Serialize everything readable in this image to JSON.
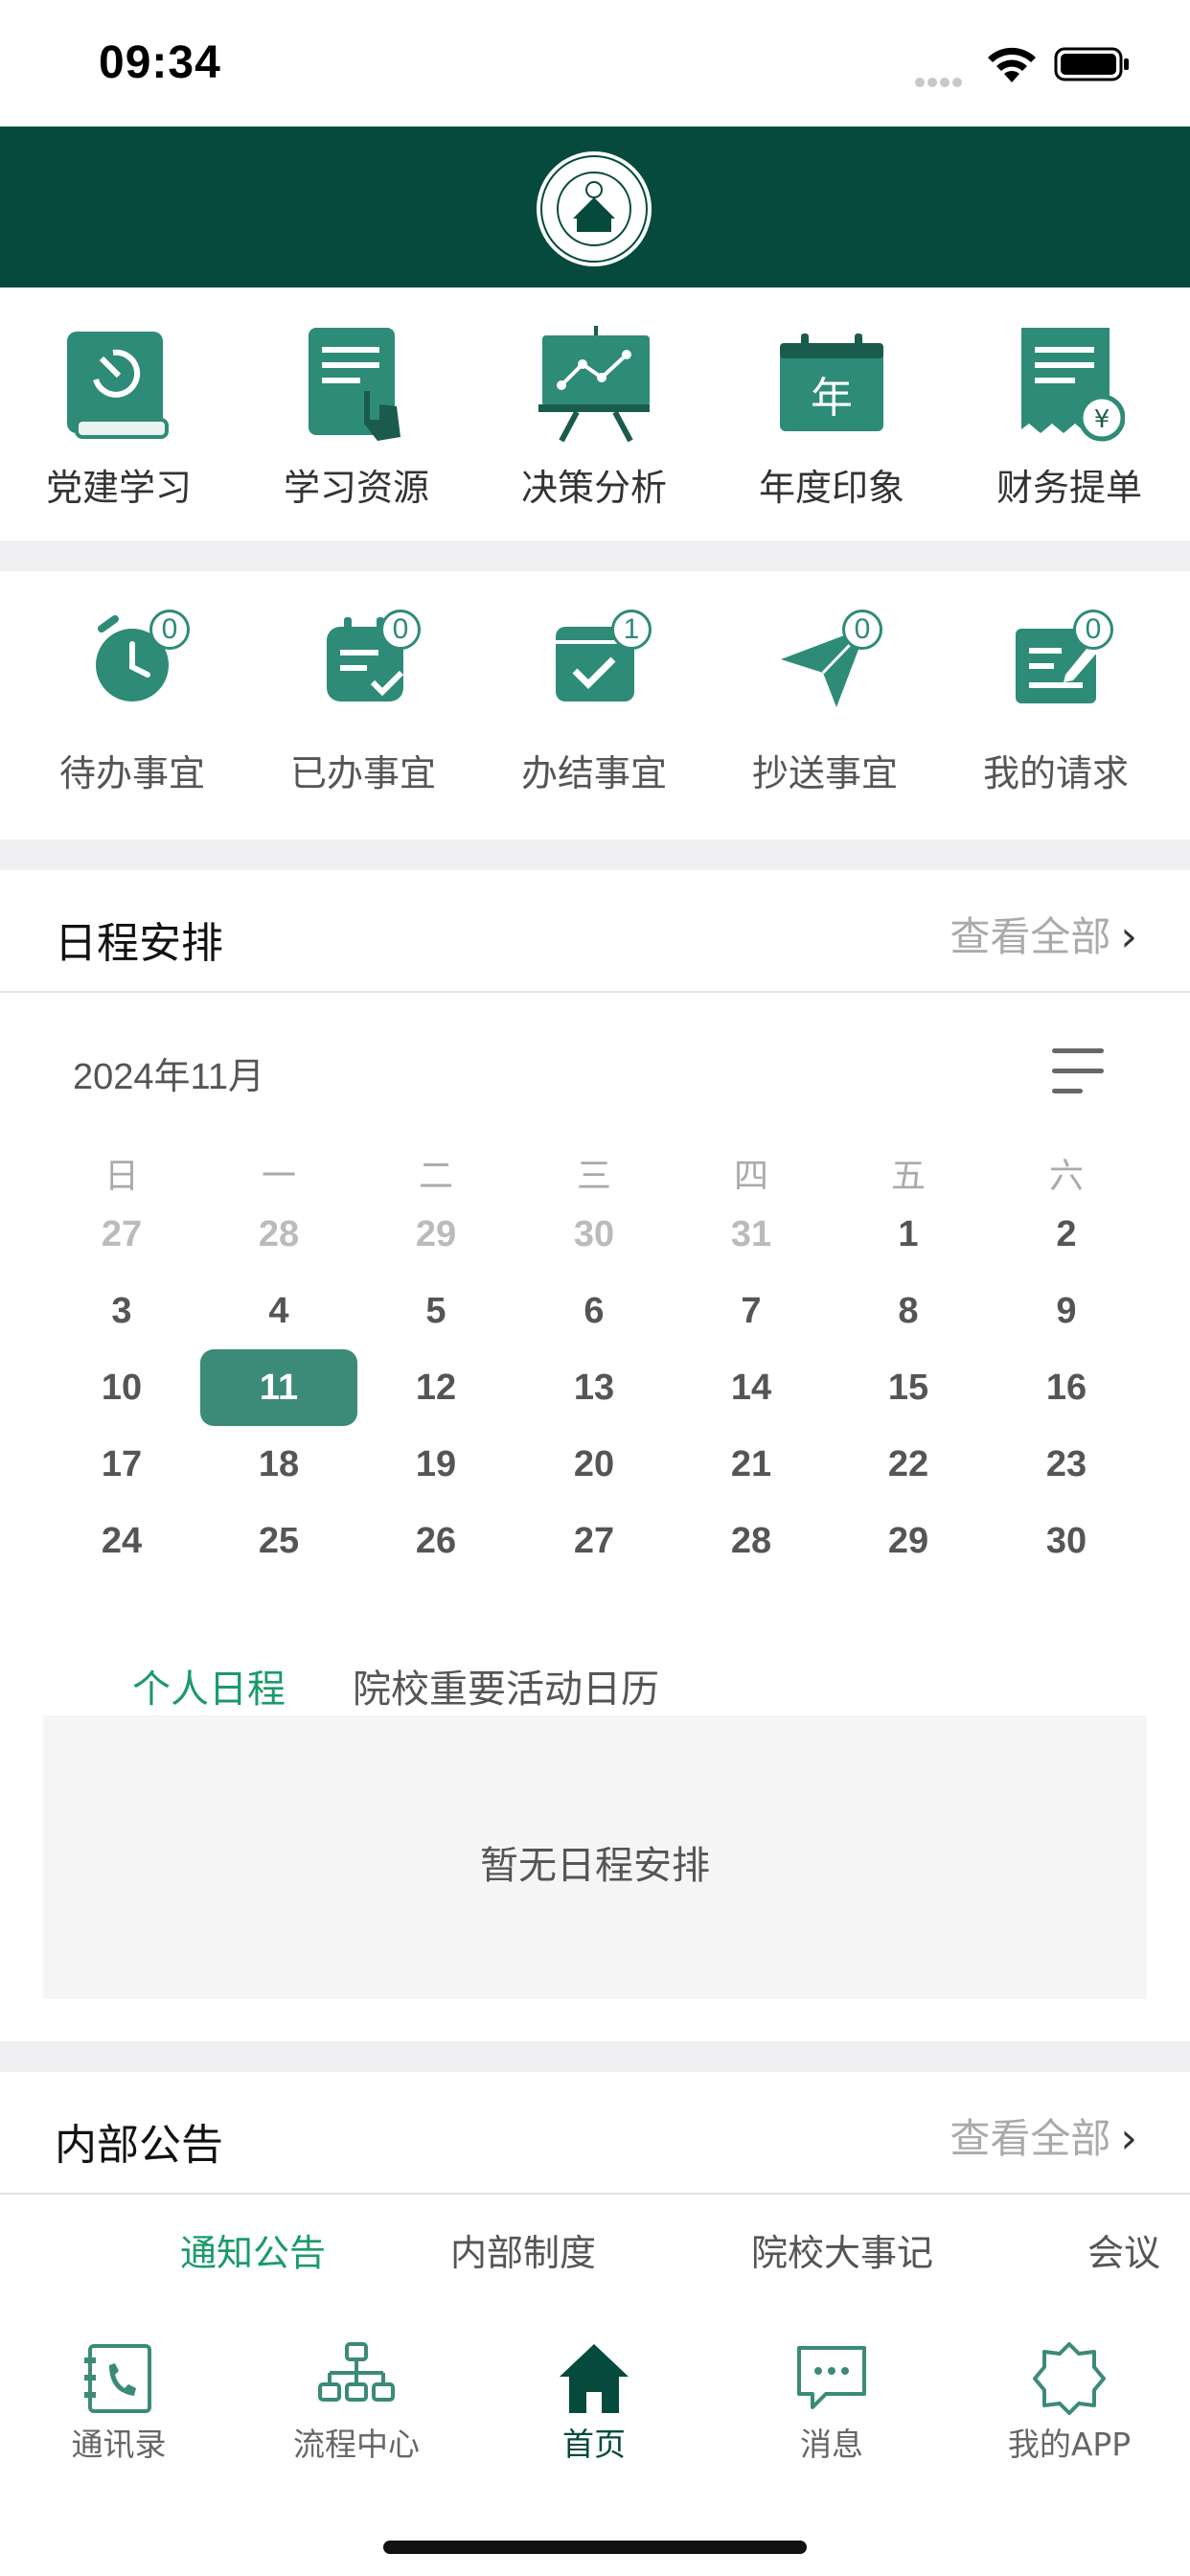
{
  "status_bar": {
    "time": "09:34"
  },
  "colors": {
    "header_bg": "#054a3d",
    "accent": "#3c8a78",
    "active_text": "#1a9a6b"
  },
  "quick_menu": [
    {
      "label": "党建学习",
      "icon": "party-book-icon"
    },
    {
      "label": "学习资源",
      "icon": "document-touch-icon"
    },
    {
      "label": "决策分析",
      "icon": "chart-board-icon"
    },
    {
      "label": "年度印象",
      "icon": "calendar-year-icon",
      "glyph": "年"
    },
    {
      "label": "财务提单",
      "icon": "receipt-yuan-icon",
      "glyph": "¥"
    }
  ],
  "tasks": [
    {
      "label": "待办事宜",
      "count": "0",
      "icon": "alarm-clock-icon"
    },
    {
      "label": "已办事宜",
      "count": "0",
      "icon": "clipboard-check-icon"
    },
    {
      "label": "办结事宜",
      "count": "1",
      "icon": "calendar-check-icon"
    },
    {
      "label": "抄送事宜",
      "count": "0",
      "icon": "paper-plane-icon"
    },
    {
      "label": "我的请求",
      "count": "0",
      "icon": "edit-note-icon"
    }
  ],
  "schedule": {
    "title": "日程安排",
    "view_all": "查看全部",
    "month": "2024年11月",
    "weekdays": [
      "日",
      "一",
      "二",
      "三",
      "四",
      "五",
      "六"
    ],
    "weeks": [
      [
        "27",
        "28",
        "29",
        "30",
        "31",
        "1",
        "2"
      ],
      [
        "3",
        "4",
        "5",
        "6",
        "7",
        "8",
        "9"
      ],
      [
        "10",
        "11",
        "12",
        "13",
        "14",
        "15",
        "16"
      ],
      [
        "17",
        "18",
        "19",
        "20",
        "21",
        "22",
        "23"
      ],
      [
        "24",
        "25",
        "26",
        "27",
        "28",
        "29",
        "30"
      ]
    ],
    "today": "11",
    "tabs": [
      "个人日程",
      "院校重要活动日历"
    ],
    "empty": "暂无日程安排"
  },
  "notices": {
    "title": "内部公告",
    "view_all": "查看全部",
    "tabs": [
      "通知公告",
      "内部制度",
      "院校大事记",
      "会议"
    ]
  },
  "bottom_nav": [
    {
      "label": "通讯录",
      "icon": "contacts-book-icon"
    },
    {
      "label": "流程中心",
      "icon": "workflow-tree-icon"
    },
    {
      "label": "首页",
      "icon": "home-icon"
    },
    {
      "label": "消息",
      "icon": "message-bubble-icon"
    },
    {
      "label": "我的APP",
      "icon": "app-gear-icon"
    }
  ]
}
